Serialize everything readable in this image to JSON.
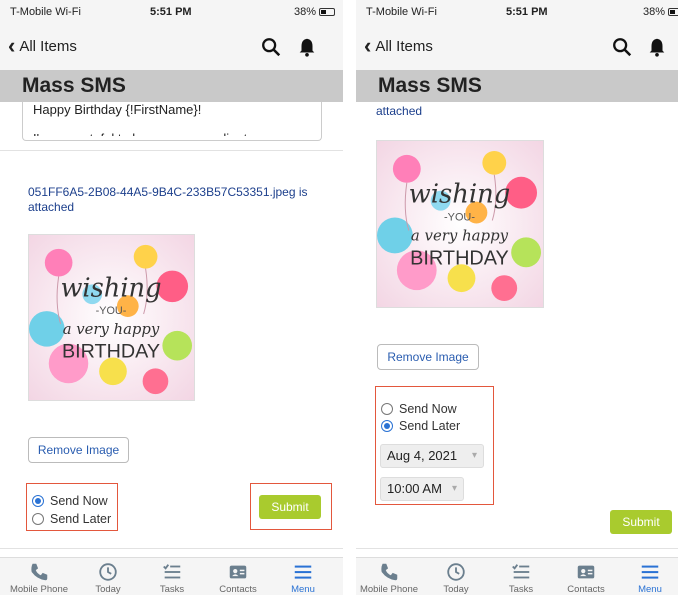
{
  "status_bar": {
    "carrier": "T-Mobile Wi-Fi",
    "time": "5:51 PM",
    "battery": "38%"
  },
  "nav": {
    "back_label": "All Items"
  },
  "page_title": "Mass SMS",
  "message": {
    "line1": "Happy Birthday {!FirstName}!",
    "line2": "I'm so grateful to have you as a client"
  },
  "attachment": {
    "left_text": "051FF6A5-2B08-44A5-9B4C-233B57C53351.jpeg is attached",
    "right_text": "attached"
  },
  "image": {
    "line1": "wishing",
    "line2": "-YOU-",
    "line3": "a very happy",
    "line4": "BIRTHDAY"
  },
  "remove_image_label": "Remove Image",
  "send_options": {
    "send_now": "Send Now",
    "send_later": "Send Later"
  },
  "submit_label": "Submit",
  "schedule": {
    "date": "Aug 4, 2021",
    "time": "10:00 AM"
  },
  "tabs": [
    {
      "label": "Mobile Phone",
      "icon": "phone-icon"
    },
    {
      "label": "Today",
      "icon": "clock-icon"
    },
    {
      "label": "Tasks",
      "icon": "tasks-icon"
    },
    {
      "label": "Contacts",
      "icon": "contact-card-icon"
    },
    {
      "label": "Menu",
      "icon": "hamburger-menu-icon"
    }
  ],
  "colors": {
    "accent": "#2a72d4",
    "submit": "#a9cb2e",
    "highlight": "#e3573d",
    "title_bar": "#c9c9c9"
  },
  "left_screen": {
    "selected_send_option": "Send Now"
  },
  "right_screen": {
    "selected_send_option": "Send Later"
  }
}
